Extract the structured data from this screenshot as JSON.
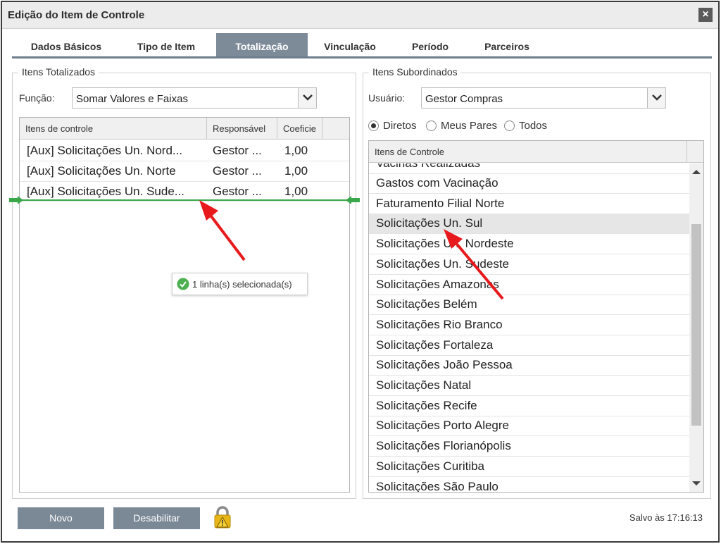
{
  "window": {
    "title": "Edição do Item de Controle",
    "close_icon": "×"
  },
  "tabs": [
    {
      "label": "Dados Básicos",
      "active": false
    },
    {
      "label": "Tipo de Item",
      "active": false
    },
    {
      "label": "Totalização",
      "active": true
    },
    {
      "label": "Vinculação",
      "active": false
    },
    {
      "label": "Período",
      "active": false
    },
    {
      "label": "Parceiros",
      "active": false
    }
  ],
  "left_panel": {
    "legend": "Itens Totalizados",
    "funcao_label": "Função:",
    "funcao_value": "Somar Valores e Faixas",
    "columns": [
      "Itens de controle",
      "Responsável",
      "Coeficie"
    ],
    "rows": [
      {
        "item": "[Aux] Solicitações Un. Nord...",
        "responsavel": "Gestor ...",
        "coeficiente": "1,00"
      },
      {
        "item": "[Aux] Solicitações Un. Norte",
        "responsavel": "Gestor ...",
        "coeficiente": "1,00"
      },
      {
        "item": "[Aux] Solicitações Un. Sude...",
        "responsavel": "Gestor ...",
        "coeficiente": "1,00"
      }
    ],
    "tooltip": "1 linha(s) selecionada(s)"
  },
  "right_panel": {
    "legend": "Itens Subordinados",
    "usuario_label": "Usuário:",
    "usuario_value": "Gestor Compras",
    "radios": [
      {
        "label": "Diretos",
        "checked": true
      },
      {
        "label": "Meus Pares",
        "checked": false
      },
      {
        "label": "Todos",
        "checked": false
      }
    ],
    "list_header": "Itens de Controle",
    "partial_item": "Vacinas Realizadas",
    "items": [
      "Gastos com Vacinação",
      "Faturamento Filial Norte",
      "Solicitações Un. Sul",
      "Solicitações Un. Nordeste",
      "Solicitações Un. Sudeste",
      "Solicitações Amazonas",
      "Solicitações Belém",
      "Solicitações Rio Branco",
      "Solicitações Fortaleza",
      "Solicitações João Pessoa",
      "Solicitações Natal",
      "Solicitações Recife",
      "Solicitações Porto Alegre",
      "Solicitações Florianópolis",
      "Solicitações Curitiba",
      "Solicitações São Paulo"
    ],
    "selected_item": "Solicitações Un. Sul"
  },
  "footer": {
    "novo_label": "Novo",
    "desabilitar_label": "Desabilitar",
    "lock_icon": "lock-warning-icon",
    "status": "Salvo às 17:16:13"
  },
  "colors": {
    "accent": "#7b8896",
    "active_tab": "#7d8b99",
    "annotation_arrow": "#e8191c",
    "drop_indicator": "#3aa84a",
    "tooltip_check": "#4caf50"
  }
}
